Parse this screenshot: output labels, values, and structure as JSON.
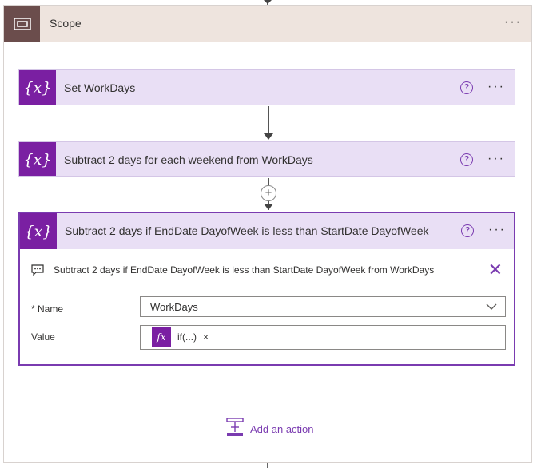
{
  "scope": {
    "title": "Scope",
    "more_icon": "ellipsis-icon",
    "more_label": "···"
  },
  "actions": [
    {
      "title": "Set WorkDays",
      "icon": "variable-icon",
      "icon_label": "{x}",
      "help": "?",
      "more": "···"
    },
    {
      "title": "Subtract 2 days for each weekend from WorkDays",
      "icon": "variable-icon",
      "icon_label": "{x}",
      "help": "?",
      "more": "···"
    },
    {
      "title": "Subtract 2 days if EndDate DayofWeek is less than StartDate DayofWeek",
      "icon": "variable-icon",
      "icon_label": "{x}",
      "help": "?",
      "more": "···",
      "description": "Subtract 2 days if EndDate DayofWeek is less than StartDate DayofWeek from WorkDays",
      "close_label": "✕",
      "name_label": "* Name",
      "name_value": "WorkDays",
      "value_label": "Value",
      "value_token": {
        "icon_label": "fx",
        "text": "if(...)",
        "remove": "×"
      }
    }
  ],
  "insert_step_label": "+",
  "add_action_label": "Add an action",
  "colors": {
    "accent": "#7a1fa2",
    "link": "#7a3bb0",
    "scope_icon_bg": "#6b4d4c",
    "scope_header_bg": "#eee4de",
    "action_bg": "#e9dff5"
  }
}
